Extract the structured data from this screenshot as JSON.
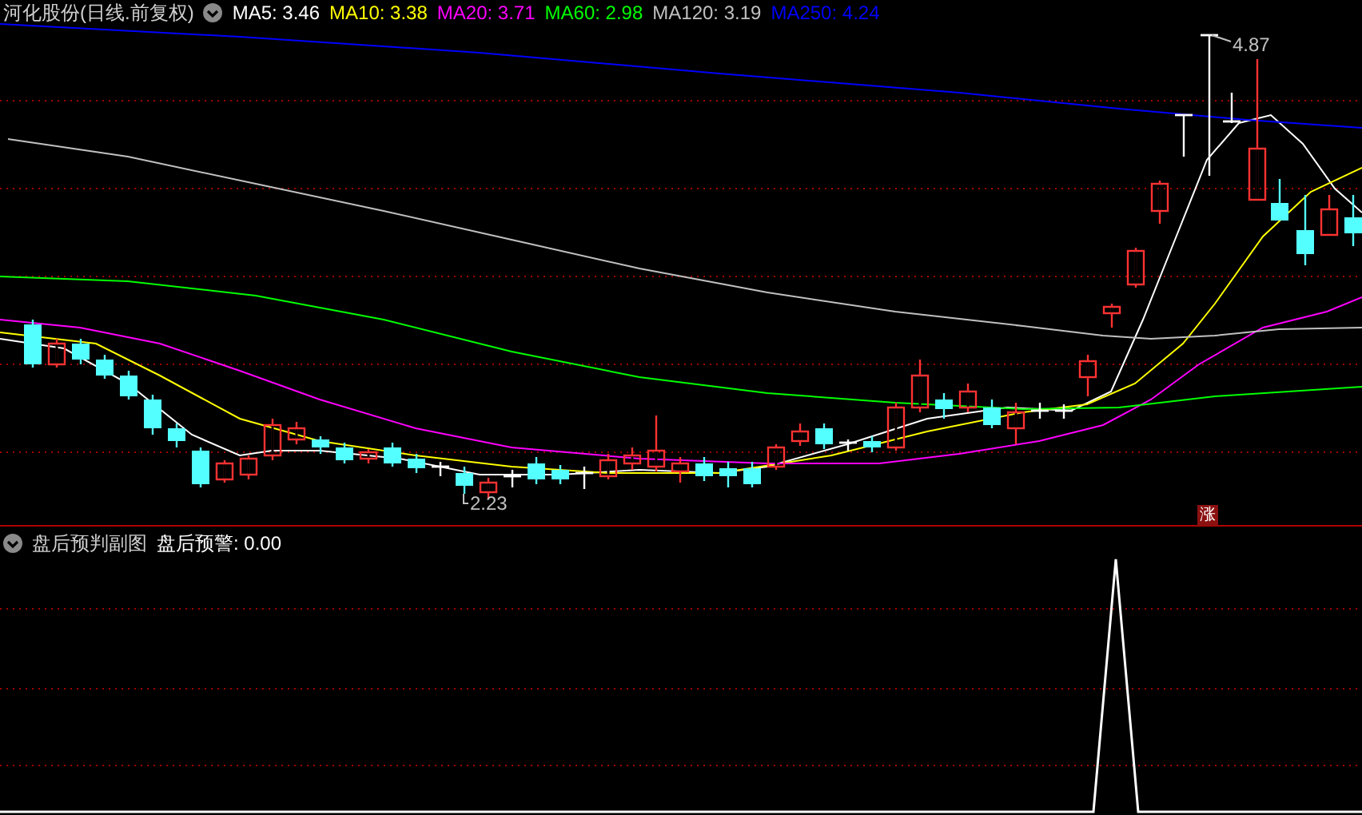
{
  "main_chart": {
    "title": "河化股份(日线.前复权)",
    "moving_averages": [
      {
        "label": "MA5: 3.46",
        "color": "#ffffff"
      },
      {
        "label": "MA10: 3.38",
        "color": "#ffff00"
      },
      {
        "label": "MA20: 3.71",
        "color": "#ff00ff"
      },
      {
        "label": "MA60: 2.98",
        "color": "#00ff00"
      },
      {
        "label": "MA120: 3.19",
        "color": "#c0c0c0"
      },
      {
        "label": "MA250: 4.24",
        "color": "#0000ff"
      }
    ],
    "high_label": "4.87",
    "low_label": "2.23",
    "badge": "涨"
  },
  "sub_chart": {
    "title": "盘后预判副图",
    "indicator": "盘后预警: 0.00"
  }
}
